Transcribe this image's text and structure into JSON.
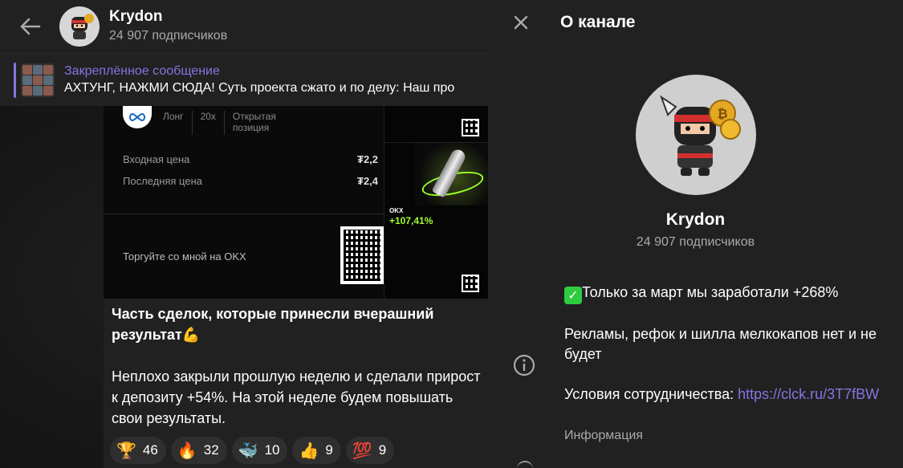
{
  "chat": {
    "channel_name": "Krydon",
    "subscribers": "24 907 подписчиков",
    "pinned_title": "Закреплённое сообщение",
    "pinned_text": "АХТУНГ, НАЖМИ СЮДА! Суть проекта сжато и по делу: Наш про"
  },
  "media": {
    "meta_long": "Лонг",
    "meta_leverage": "20x",
    "meta_position": "Открытая позиция",
    "entry_label": "Входная цена",
    "entry_value": "₮2,2",
    "last_label": "Последняя цена",
    "last_value": "₮2,4",
    "trade_label": "Торгуйте со мной на OKX",
    "okx_label": "OKX",
    "pct": "+107,41%"
  },
  "message": {
    "bold_text": "Часть сделок, которые принесли вчерашний результат💪",
    "body_text": "Неплохо закрыли прошлую неделю и сделали прирост к депозиту +54%. На этой неделе будем повышать свои результаты."
  },
  "reactions": [
    {
      "emoji": "🏆",
      "count": "46"
    },
    {
      "emoji": "🔥",
      "count": "32"
    },
    {
      "emoji": "🐳",
      "count": "10"
    },
    {
      "emoji": "👍",
      "count": "9"
    },
    {
      "emoji": "💯",
      "count": "9"
    }
  ],
  "panel": {
    "title": "О канале",
    "name": "Krydon",
    "subscribers": "24 907 подписчиков",
    "line1": "Только за март мы заработали +268%",
    "line2": "Рекламы, рефок и шилла мелкокапов нет и не будет",
    "line3_prefix": "Условия сотрудничества: ",
    "link": "https://clck.ru/3T7fBW",
    "info_label": "Информация"
  },
  "colors": {
    "accent": "#8774e1",
    "panel_bg": "#212121",
    "chat_bg": "#171717"
  }
}
